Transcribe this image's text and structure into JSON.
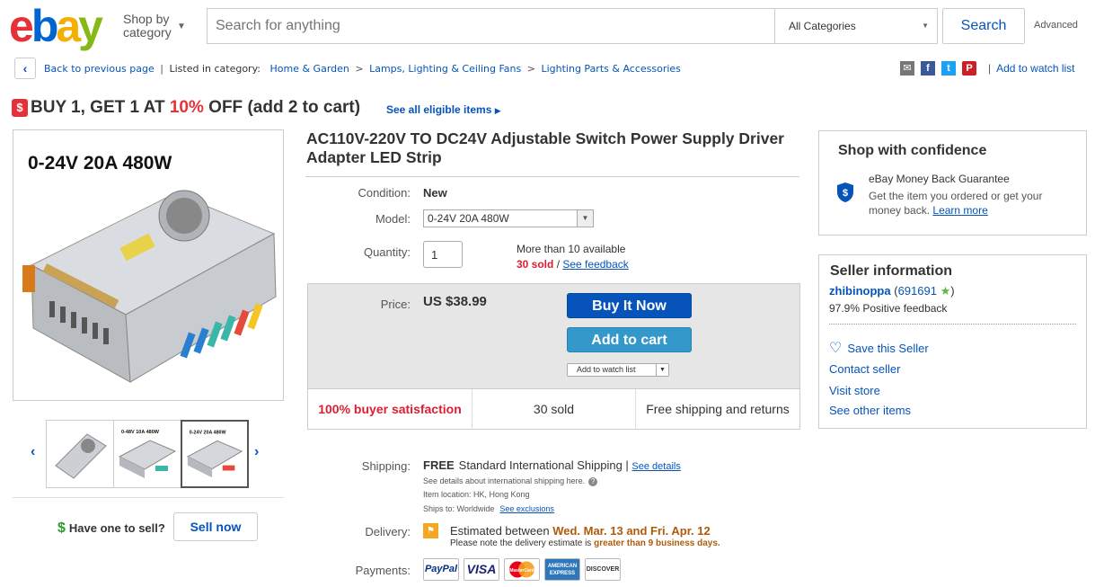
{
  "header": {
    "logo": {
      "e": "e",
      "b": "b",
      "a": "a",
      "y": "y"
    },
    "shop_by": "Shop by category",
    "search_placeholder": "Search for anything",
    "category": "All Categories",
    "search_button": "Search",
    "advanced": "Advanced"
  },
  "breadcrumb": {
    "back": "Back to previous page",
    "listed": "Listed in category:",
    "items": [
      "Home & Garden",
      "Lamps, Lighting & Ceiling Fans",
      "Lighting Parts & Accessories"
    ]
  },
  "share": {
    "watch_link": "Add to watch list"
  },
  "promo": {
    "badge": "$",
    "text_pre": "BUY 1, GET 1 AT ",
    "pct": "10%",
    "text_post": " OFF (add 2 to cart)",
    "link": "See all eligible items"
  },
  "gallery": {
    "image_banner": "0-24V 20A 480W",
    "thumbs": [
      "",
      "0-48V 10A 480W",
      "0-24V 20A 480W"
    ]
  },
  "sell": {
    "label": "Have one to sell?",
    "button": "Sell now"
  },
  "product": {
    "title": "AC110V-220V TO DC24V Adjustable Switch Power Supply Driver Adapter LED Strip",
    "condition_label": "Condition:",
    "condition": "New",
    "model_label": "Model:",
    "model": "0-24V 20A 480W",
    "quantity_label": "Quantity:",
    "quantity": "1",
    "available": "More than 10 available",
    "sold": "30 sold",
    "feedback_link": "See feedback",
    "price_label": "Price:",
    "price": "US $38.99",
    "buy_now": "Buy It Now",
    "add_cart": "Add to cart",
    "add_watch": "Add to watch list",
    "stats": [
      "100% buyer satisfaction",
      "30 sold",
      "Free shipping and returns"
    ]
  },
  "shipping": {
    "label": "Shipping:",
    "free": "FREE",
    "method": "Standard International Shipping",
    "details_link": "See details",
    "intl": "See details about international shipping here.",
    "location": "Item location:  HK, Hong Kong",
    "ships_to": "Ships to:  Worldwide",
    "exclusions": "See exclusions",
    "delivery_label": "Delivery:",
    "delivery_pre": "Estimated between ",
    "delivery_dates": "Wed. Mar. 13 and Fri. Apr. 12",
    "delivery_note_pre": "Please note the delivery estimate is ",
    "delivery_note_em": "greater than 9 business days.",
    "payments_label": "Payments:",
    "payments": [
      "PayPal",
      "VISA",
      "MasterCard",
      "AMERICAN EXPRESS",
      "DISCOVER"
    ]
  },
  "confidence": {
    "title": "Shop with confidence",
    "head": "eBay Money Back Guarantee",
    "body": "Get the item you ordered or get your money back.",
    "link": "Learn more"
  },
  "seller": {
    "title": "Seller information",
    "name": "zhibinoppa",
    "score": "691691",
    "feedback": "97.9% Positive feedback",
    "save": "Save this Seller",
    "contact": "Contact seller",
    "store": "Visit store",
    "other": "See other items"
  },
  "colors": {
    "brand_blue": "#0654ba",
    "red": "#e53238",
    "cart_blue": "#3498ca",
    "delivery": "#b05a0a"
  }
}
